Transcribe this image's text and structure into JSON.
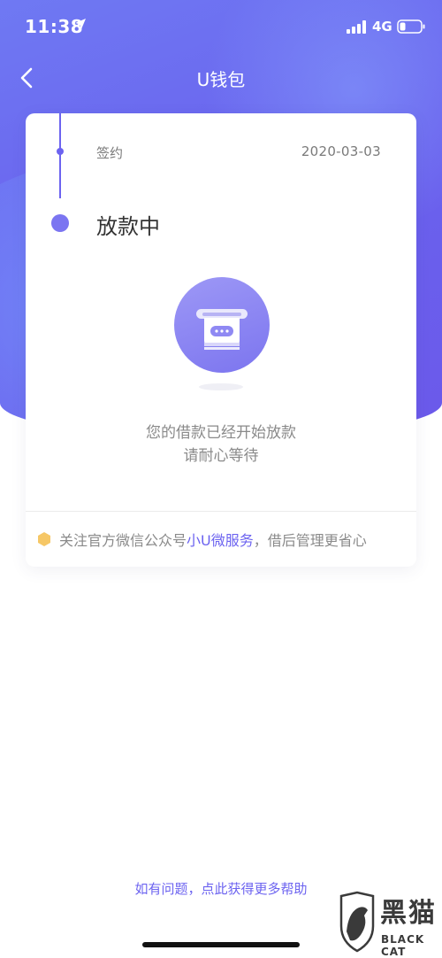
{
  "status_bar": {
    "time": "11:38",
    "network": "4G"
  },
  "nav": {
    "title": "U钱包"
  },
  "timeline": {
    "prev_step_label": "签约",
    "prev_step_date": "2020-03-03",
    "current_status": "放款中"
  },
  "message": {
    "line1": "您的借款已经开始放款",
    "line2": "请耐心等待"
  },
  "follow": {
    "prefix": "关注官方微信公众号",
    "link": "小U微服务",
    "suffix": "，借后管理更省心"
  },
  "help": {
    "link_text": "如有问题，点此获得更多帮助"
  },
  "watermark": {
    "text": "黑猫",
    "sub": "BLACK CAT"
  },
  "colors": {
    "accent": "#6c63f0",
    "hero_start": "#6f79f3",
    "hero_end": "#6b59ea",
    "icon_hex": "#f6c766"
  }
}
